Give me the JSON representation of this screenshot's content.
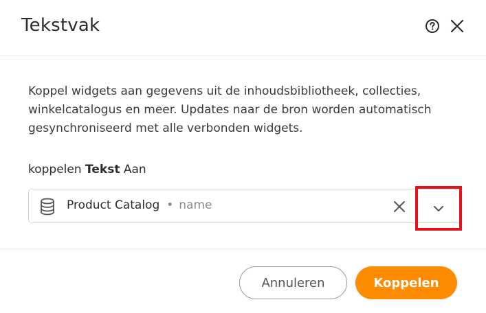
{
  "dialog": {
    "title": "Tekstvak",
    "description": "Koppel widgets aan gegevens uit de inhoudsbibliotheek, collecties, winkelcatalogus en meer. Updates naar de bron worden automatisch gesynchroniseerd met alle verbonden widgets.",
    "connect_prefix": "koppelen",
    "connect_bold": "Tekst",
    "connect_suffix": "Aan"
  },
  "source_select": {
    "value": "Product Catalog",
    "separator": "•",
    "field": "name",
    "icon": "database-icon"
  },
  "footer": {
    "cancel_label": "Annuleren",
    "connect_label": "Koppelen"
  },
  "colors": {
    "primary": "#ff8c00",
    "highlight": "#e3131b"
  }
}
